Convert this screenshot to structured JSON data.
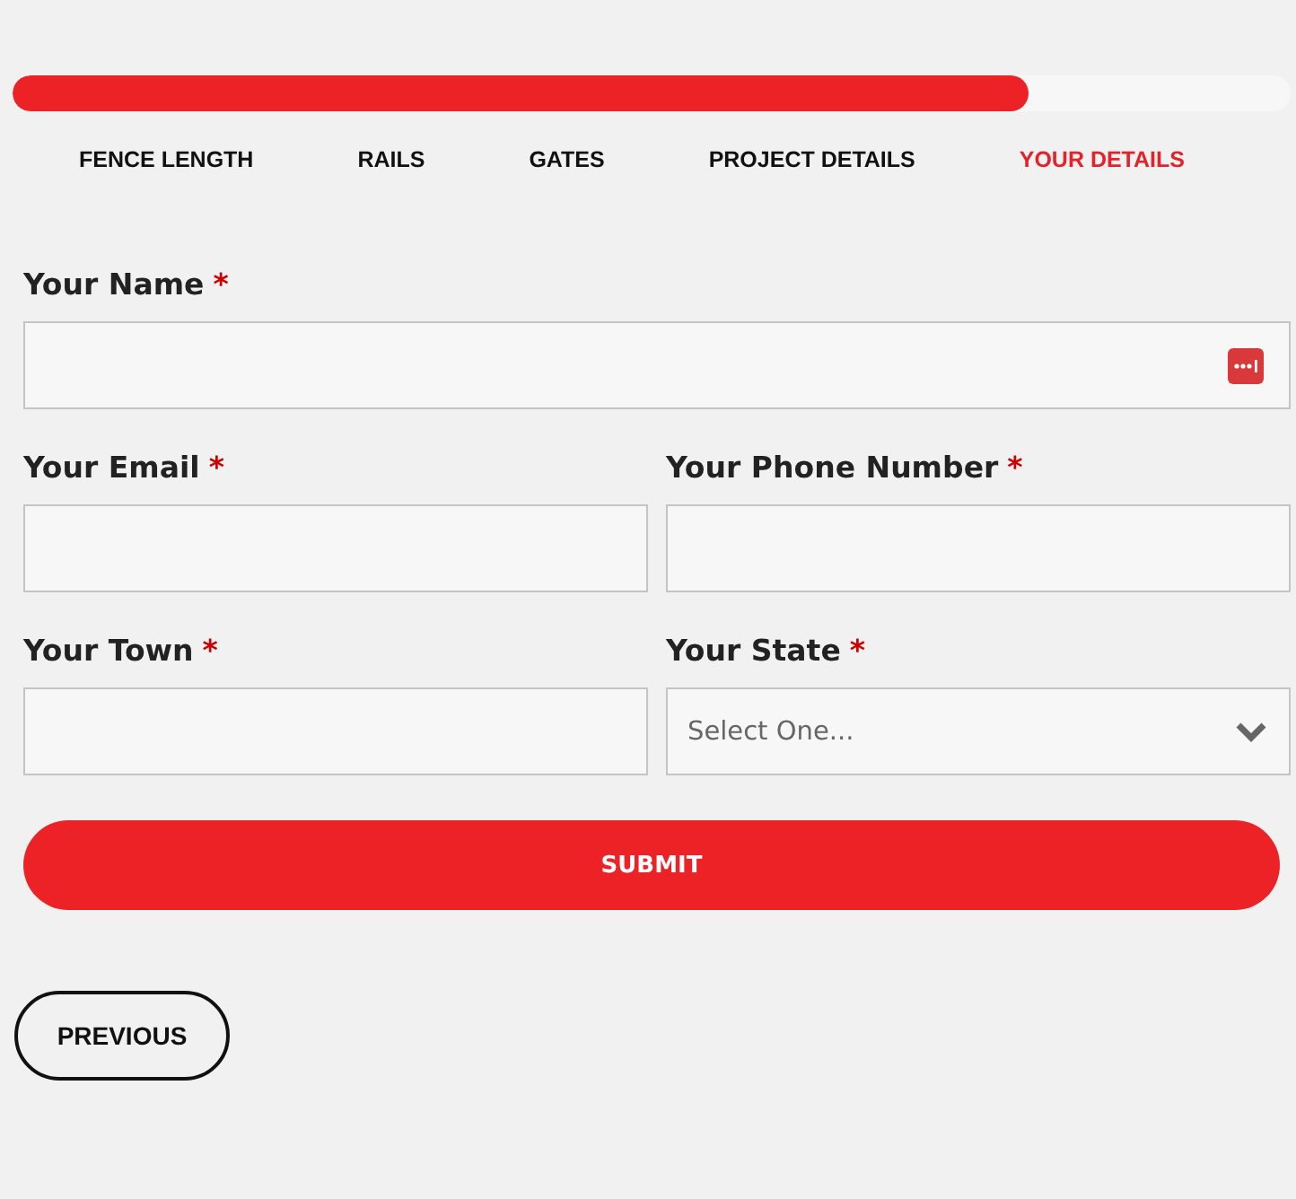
{
  "progress": {
    "level": 0.795
  },
  "steps": [
    {
      "label": "FENCE LENGTH",
      "selected": false
    },
    {
      "label": "RAILS",
      "selected": false
    },
    {
      "label": "GATES",
      "selected": false
    },
    {
      "label": "PROJECT DETAILS",
      "selected": false
    },
    {
      "label": "YOUR DETAILS",
      "selected": true
    }
  ],
  "form_rows": [
    [
      {
        "label": "Your Name",
        "required_mark": "*",
        "kind": "text",
        "autofill_icon": true
      }
    ],
    [
      {
        "label": "Your Email",
        "required_mark": "*",
        "kind": "text"
      },
      {
        "label": "Your Phone Number",
        "required_mark": "*",
        "kind": "text"
      }
    ],
    [
      {
        "label": "Your Town",
        "required_mark": "*",
        "kind": "text"
      },
      {
        "label": "Your State",
        "required_mark": "*",
        "kind": "select",
        "value": "Select One..."
      }
    ]
  ],
  "submit_button": "SUBMIT",
  "previous_button": "PREVIOUS"
}
